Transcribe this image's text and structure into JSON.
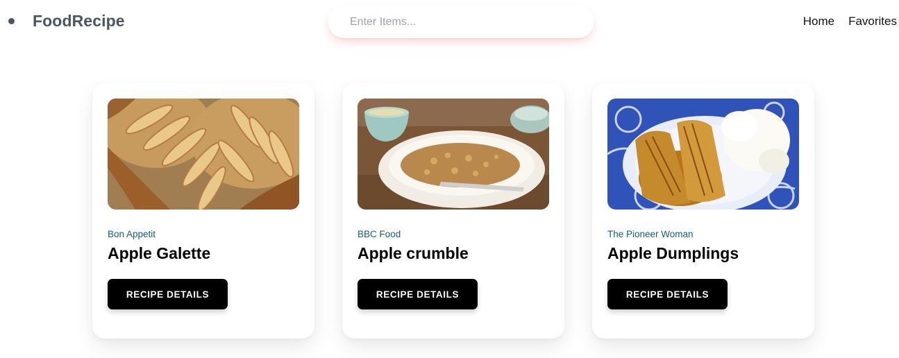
{
  "brand": {
    "name": "FoodRecipe"
  },
  "search": {
    "placeholder": "Enter Items..."
  },
  "nav": {
    "home": "Home",
    "favorites": "Favorites"
  },
  "recipes": [
    {
      "publisher": "Bon Appetit",
      "title": "Apple Galette",
      "button": "RECIPE DETAILS"
    },
    {
      "publisher": "BBC Food",
      "title": "Apple crumble",
      "button": "RECIPE DETAILS"
    },
    {
      "publisher": "The Pioneer Woman",
      "title": "Apple Dumplings",
      "button": "RECIPE DETAILS"
    }
  ]
}
